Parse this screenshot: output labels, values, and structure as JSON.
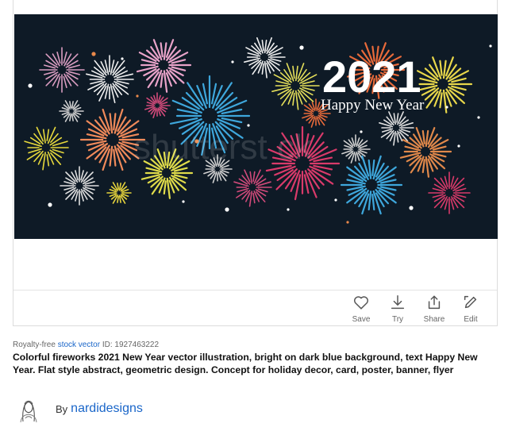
{
  "image": {
    "headline": "2021",
    "subheadline": "Happy New Year",
    "watermark": "shutterst  ck"
  },
  "actions": [
    {
      "label": "Save",
      "icon": "heart-icon"
    },
    {
      "label": "Try",
      "icon": "download-icon"
    },
    {
      "label": "Share",
      "icon": "share-icon"
    },
    {
      "label": "Edit",
      "icon": "edit-icon"
    }
  ],
  "meta": {
    "prefix": "Royalty-free",
    "type_link": "stock vector",
    "id_text": "ID: 1927463222"
  },
  "description": "Colorful fireworks 2021 New Year vector illustration, bright on dark blue background, text Happy New Year. Flat style abstract, geometric design. Concept for holiday decor, card, poster, banner, flyer",
  "author": {
    "prefix": "By",
    "name": "nardidesigns"
  },
  "colors": {
    "background": "#0e1a26",
    "link": "#1a66c9"
  }
}
